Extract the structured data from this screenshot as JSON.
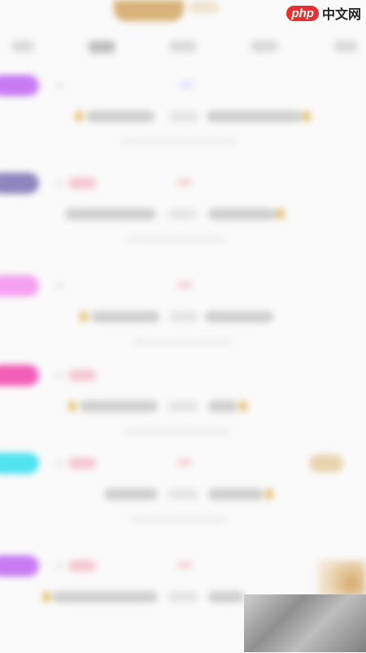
{
  "watermark": {
    "brand": "php",
    "site": "中文网"
  },
  "colors": {
    "pill_1": "#c77af2",
    "pill_2": "#8f86bf",
    "pill_3": "#f5a0f0",
    "pill_4": "#f25fb8",
    "pill_5": "#4fe2f0",
    "pill_6": "#c77af2"
  },
  "icons": {
    "brand_logo": "php-badge-icon"
  }
}
